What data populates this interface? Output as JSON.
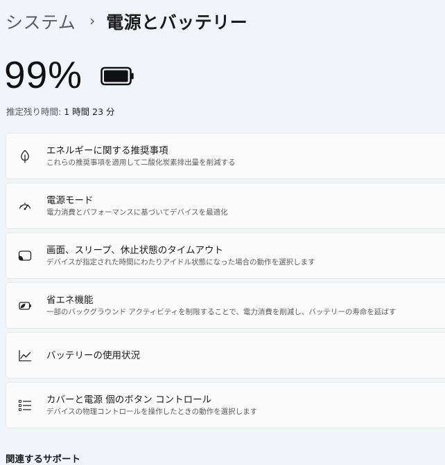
{
  "breadcrumb": {
    "parent": "システム",
    "separator": "›",
    "current": "電源とバッテリー"
  },
  "battery": {
    "percent_text": "99%",
    "level": 0.99,
    "icon": "battery-icon"
  },
  "remaining": {
    "label": "推定残り時間:",
    "value": "1 時間 23 分"
  },
  "items": [
    {
      "title": "エネルギーに関する推奨事項",
      "subtitle": "これらの推奨事項を適用して二酸化炭素排出量を削減する",
      "icon": "leaf-icon"
    },
    {
      "title": "電源モード",
      "subtitle": "電力消費とパフォーマンスに基づいてデバイスを最適化",
      "icon": "gauge-icon"
    },
    {
      "title": "画面、スリープ、休止状態のタイムアウト",
      "subtitle": "デバイスが指定された時間にわたりアイドル状態になった場合の動作を選択します",
      "icon": "screen-sleep-icon"
    },
    {
      "title": "省エネ機能",
      "subtitle": "一部のバックグラウンド アクティビティを制限することで、電力消費を削減し、バッテリーの寿命を延ばす",
      "icon": "battery-saver-icon"
    },
    {
      "title": "バッテリーの使用状況",
      "icon": "chart-line-icon"
    },
    {
      "title": "カバーと電源 個のボタン コントロール",
      "subtitle": "デバイスの物理コントロールを操作したときの動作を選択します",
      "icon": "list-icon"
    }
  ],
  "related_support": {
    "heading": "関連するサポート"
  }
}
